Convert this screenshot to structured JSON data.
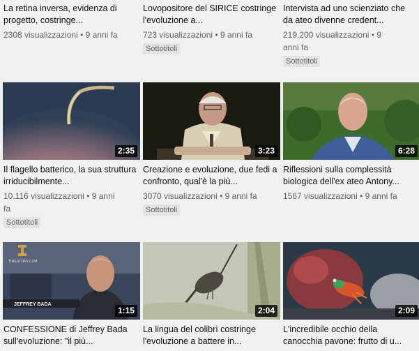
{
  "videos": [
    {
      "title": "La retina inversa, evidenza di progetto, costringe...",
      "views": "2308 visualizzazioni",
      "sep": "•",
      "age": "9 anni fa",
      "badge": ""
    },
    {
      "title": "Lovopositore del SIRICE costringe l'evoluzione a...",
      "views": "723 visualizzazioni",
      "sep": "•",
      "age": "9 anni fa",
      "badge": "Sottotitoli"
    },
    {
      "title": "Intervista ad uno scienziato che da ateo divenne credent...",
      "views": "219.200 visualizzazioni",
      "sep": "•",
      "age": "9 anni fa",
      "badge": "Sottotitoli"
    },
    {
      "title": "Il flagello batterico, la sua struttura irriducibilmente...",
      "views": "10.116 visualizzazioni",
      "sep": "•",
      "age": "9 anni fa",
      "badge": "Sottotitoli",
      "duration": "2:35"
    },
    {
      "title": "Creazione e evoluzione, due fedi a confronto, qual'è la più...",
      "views": "3070 visualizzazioni",
      "sep": "•",
      "age": "9 anni fa",
      "badge": "Sottotitoli",
      "duration": "3:23"
    },
    {
      "title": "Riflessioni sulla complessità biologica dell'ex ateo Antony...",
      "views": "1567 visualizzazioni",
      "sep": "•",
      "age": "9 anni fa",
      "badge": "",
      "duration": "6:28"
    },
    {
      "title": "CONFESSIONE di Jeffrey Bada sull'evoluzione: \"il più...",
      "duration": "1:15",
      "thumb_text": [
        "TIMESTORY.COM",
        "JEFFREY BADA"
      ]
    },
    {
      "title": "La lingua del colibrì costringe l'evoluzione a battere in...",
      "duration": "2:04"
    },
    {
      "title": "L'incredibile occhio della canocchia pavone: frutto di u...",
      "duration": "2:09"
    }
  ]
}
